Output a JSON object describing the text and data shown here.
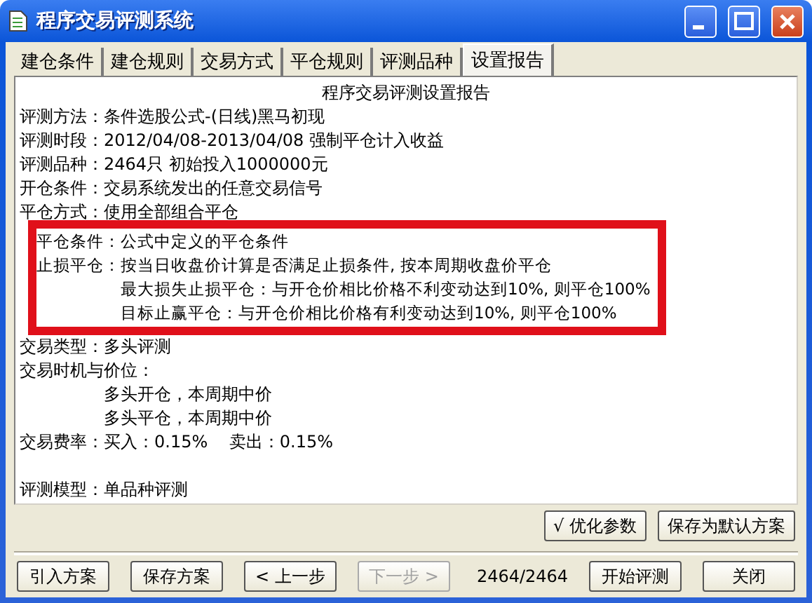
{
  "window": {
    "title": "程序交易评测系统"
  },
  "tabs": [
    {
      "label": "建仓条件",
      "selected": false
    },
    {
      "label": "建仓规则",
      "selected": false
    },
    {
      "label": "交易方式",
      "selected": false
    },
    {
      "label": "平仓规则",
      "selected": false
    },
    {
      "label": "评测品种",
      "selected": false
    },
    {
      "label": "设置报告",
      "selected": true
    }
  ],
  "report": {
    "title": "程序交易评测设置报告",
    "sections": [
      {
        "kind": "plain",
        "lines": [
          {
            "kind": "row",
            "text": "评测方法：条件选股公式-(日线)黑马初现"
          },
          {
            "kind": "row",
            "text": "评测时段：2012/04/08-2013/04/08 强制平仓计入收益"
          },
          {
            "kind": "row",
            "text": "评测品种：2464只 初始投入1000000元"
          },
          {
            "kind": "row",
            "text": "开仓条件：交易系统发出的任意交易信号"
          },
          {
            "kind": "row",
            "text": "平仓方式：使用全部组合平仓"
          }
        ]
      },
      {
        "kind": "highlighted",
        "lines": [
          {
            "kind": "row",
            "text": "平仓条件：公式中定义的平仓条件"
          },
          {
            "kind": "row",
            "text": "止损平仓：按当日收盘价计算是否满足止损条件, 按本周期收盘价平仓"
          },
          {
            "kind": "continuation",
            "text": "最大损失止损平仓：与开仓价相比价格不利变动达到10%, 则平仓100%"
          },
          {
            "kind": "continuation",
            "text": "目标止赢平仓：与开仓价相比价格有利变动达到10%, 则平仓100%"
          }
        ]
      },
      {
        "kind": "plain",
        "lines": [
          {
            "kind": "row",
            "text": "交易类型：多头评测"
          },
          {
            "kind": "row",
            "text": "交易时机与价位："
          },
          {
            "kind": "continuation",
            "text": "多头开仓，本周期中价"
          },
          {
            "kind": "continuation",
            "text": "多头平仓，本周期中价"
          },
          {
            "kind": "row",
            "text": "交易费率：买入：0.15%    卖出：0.15%"
          },
          {
            "kind": "spaced",
            "text": "评测模型：单品种评测"
          }
        ]
      }
    ]
  },
  "option_buttons": [
    {
      "label": "√ 优化参数"
    },
    {
      "label": "保存为默认方案"
    }
  ],
  "footer": {
    "buttons": [
      {
        "label": "引入方案",
        "disabled": false
      },
      {
        "label": "保存方案",
        "disabled": false
      },
      {
        "label": "< 上一步",
        "disabled": false
      },
      {
        "label": "下一步 >",
        "disabled": true
      }
    ],
    "counter": "2464/2464",
    "right_buttons": [
      {
        "label": "开始评测",
        "disabled": false
      },
      {
        "label": "关闭",
        "disabled": false
      }
    ]
  }
}
